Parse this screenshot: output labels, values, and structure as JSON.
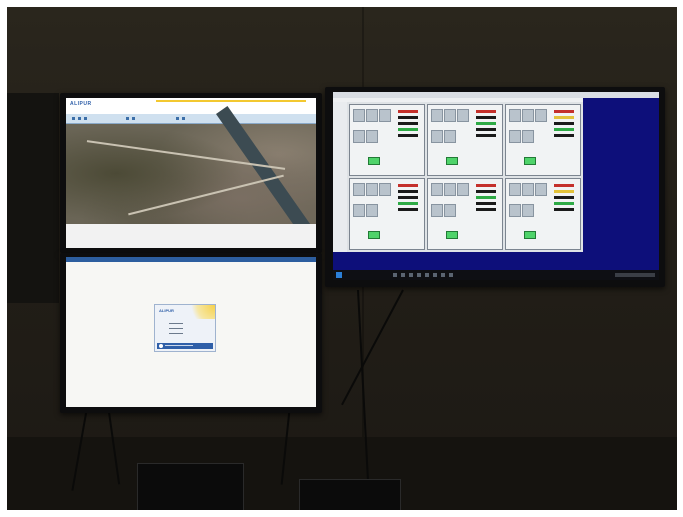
{
  "scene": {
    "colors": {
      "wall": "#2a261d",
      "frame": "#0d0d0e",
      "dashboard_background": "#0d0f7a",
      "map_accent_blue": "#2f5fa8",
      "status_green": "#4fd36a",
      "status_red": "#c4302b"
    },
    "monitors": {
      "top_left": {
        "app_logo": "ALIPUR"
      },
      "bottom_left": {
        "dialog_logo": "ALIPUR"
      },
      "right": {
        "panels_shown": 6,
        "status_icons": [
          "start-icon",
          "taskbar-app-icons",
          "system-tray"
        ]
      }
    }
  }
}
